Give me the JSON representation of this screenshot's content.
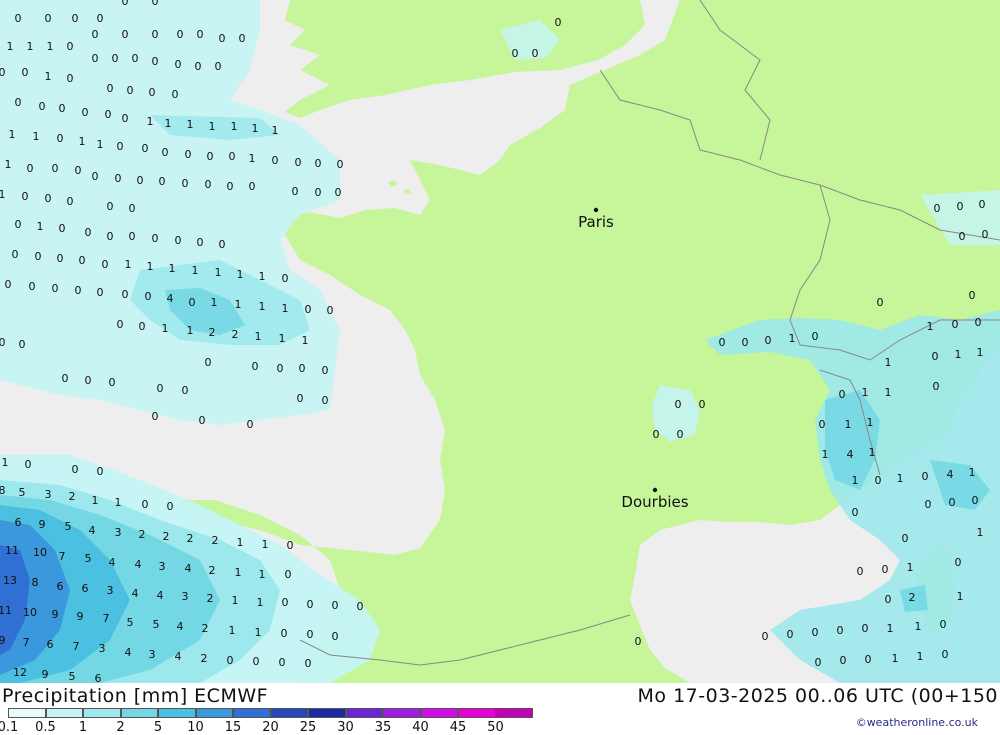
{
  "footer": {
    "title": "Precipitation [mm] ECMWF",
    "datetime": "Mo 17-03-2025 00..06 UTC (00+150",
    "credit": "©weatheronline.co.uk"
  },
  "legend": {
    "items": [
      {
        "label": "0.1",
        "color": "#e8fcfc"
      },
      {
        "label": "0.5",
        "color": "#c4f4f4"
      },
      {
        "label": "1",
        "color": "#9ce8ec"
      },
      {
        "label": "2",
        "color": "#74d8e4"
      },
      {
        "label": "5",
        "color": "#4cc0e0"
      },
      {
        "label": "10",
        "color": "#3c98dc"
      },
      {
        "label": "15",
        "color": "#3070d4"
      },
      {
        "label": "20",
        "color": "#2448bc"
      },
      {
        "label": "25",
        "color": "#1c2ca4"
      },
      {
        "label": "30",
        "color": "#6c24d4"
      },
      {
        "label": "35",
        "color": "#a01ce0"
      },
      {
        "label": "40",
        "color": "#d00ce8"
      },
      {
        "label": "45",
        "color": "#e800d8"
      },
      {
        "label": "50",
        "color": "#c400b4"
      }
    ]
  },
  "cities": [
    {
      "name": "Paris"
    },
    {
      "name": "Dourbies"
    }
  ],
  "colors": {
    "land": "#c6f59a",
    "sea": "#eeeeee",
    "border": "#888888"
  }
}
